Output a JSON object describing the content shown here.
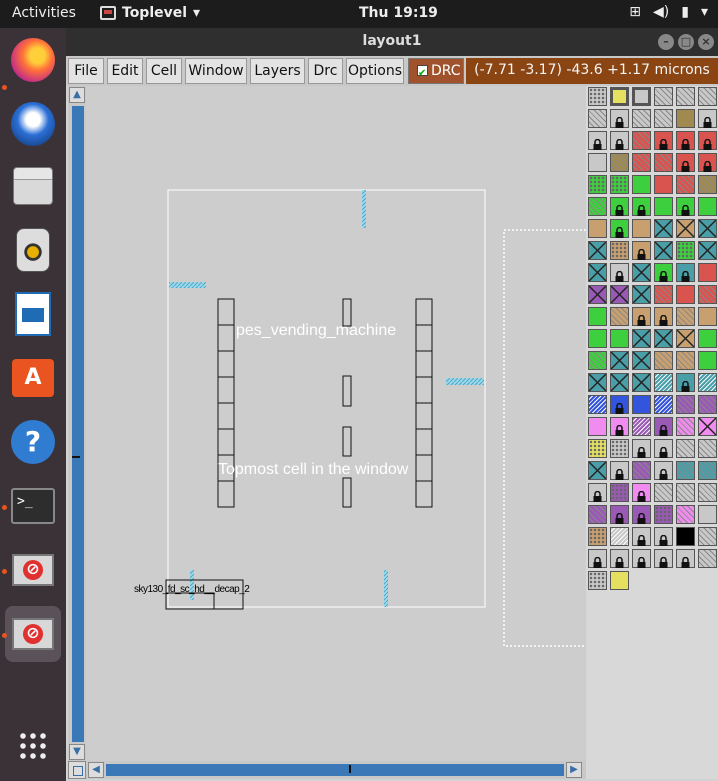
{
  "topbar": {
    "activities": "Activities",
    "app_name": "Toplevel",
    "app_menu_arrow": "▾",
    "clock": "Thu 19:19",
    "tray_icons": [
      "network-icon",
      "volume-icon",
      "battery-icon",
      "power-menu-icon"
    ]
  },
  "dock": {
    "items": [
      {
        "name": "firefox",
        "running": true
      },
      {
        "name": "thunderbird",
        "running": false
      },
      {
        "name": "files",
        "running": false
      },
      {
        "name": "rhythmbox",
        "running": false
      },
      {
        "name": "libreoffice-writer",
        "running": false
      },
      {
        "name": "ubuntu-software",
        "running": false
      },
      {
        "name": "help",
        "running": false
      },
      {
        "name": "terminal",
        "running": true
      },
      {
        "name": "magic-window",
        "running": true
      },
      {
        "name": "magic-window-active",
        "running": true
      }
    ],
    "show_apps_icon": "app-grid-icon"
  },
  "window": {
    "title": "layout1",
    "controls": {
      "minimize": "–",
      "maximize": "□",
      "close": "×"
    }
  },
  "menubar": {
    "file": "File",
    "edit": "Edit",
    "cell": "Cell",
    "window": "Window",
    "layers": "Layers",
    "drc": "Drc",
    "options": "Options",
    "drc_toggle": "DRC",
    "coordinates": "(-7.71 -3.17) -43.6 +1.17 microns"
  },
  "canvas": {
    "cell_name": "pes_vending_machine",
    "window_label": "Topmost cell in the window",
    "subcell_label": "sky130_fd_sc_hd__decap_2"
  },
  "palette": {
    "colors": {
      "gray": "#c8c8c8",
      "red": "#d9534f",
      "green": "#3ecf3e",
      "tan": "#c8a070",
      "blue": "#3355dd",
      "teal": "#4a9ea8",
      "purple": "#9b59b6",
      "pink": "#f08cf0",
      "yellow": "#e6e060",
      "olive": "#a08a50",
      "black": "#000000",
      "white": "#ffffff"
    }
  }
}
